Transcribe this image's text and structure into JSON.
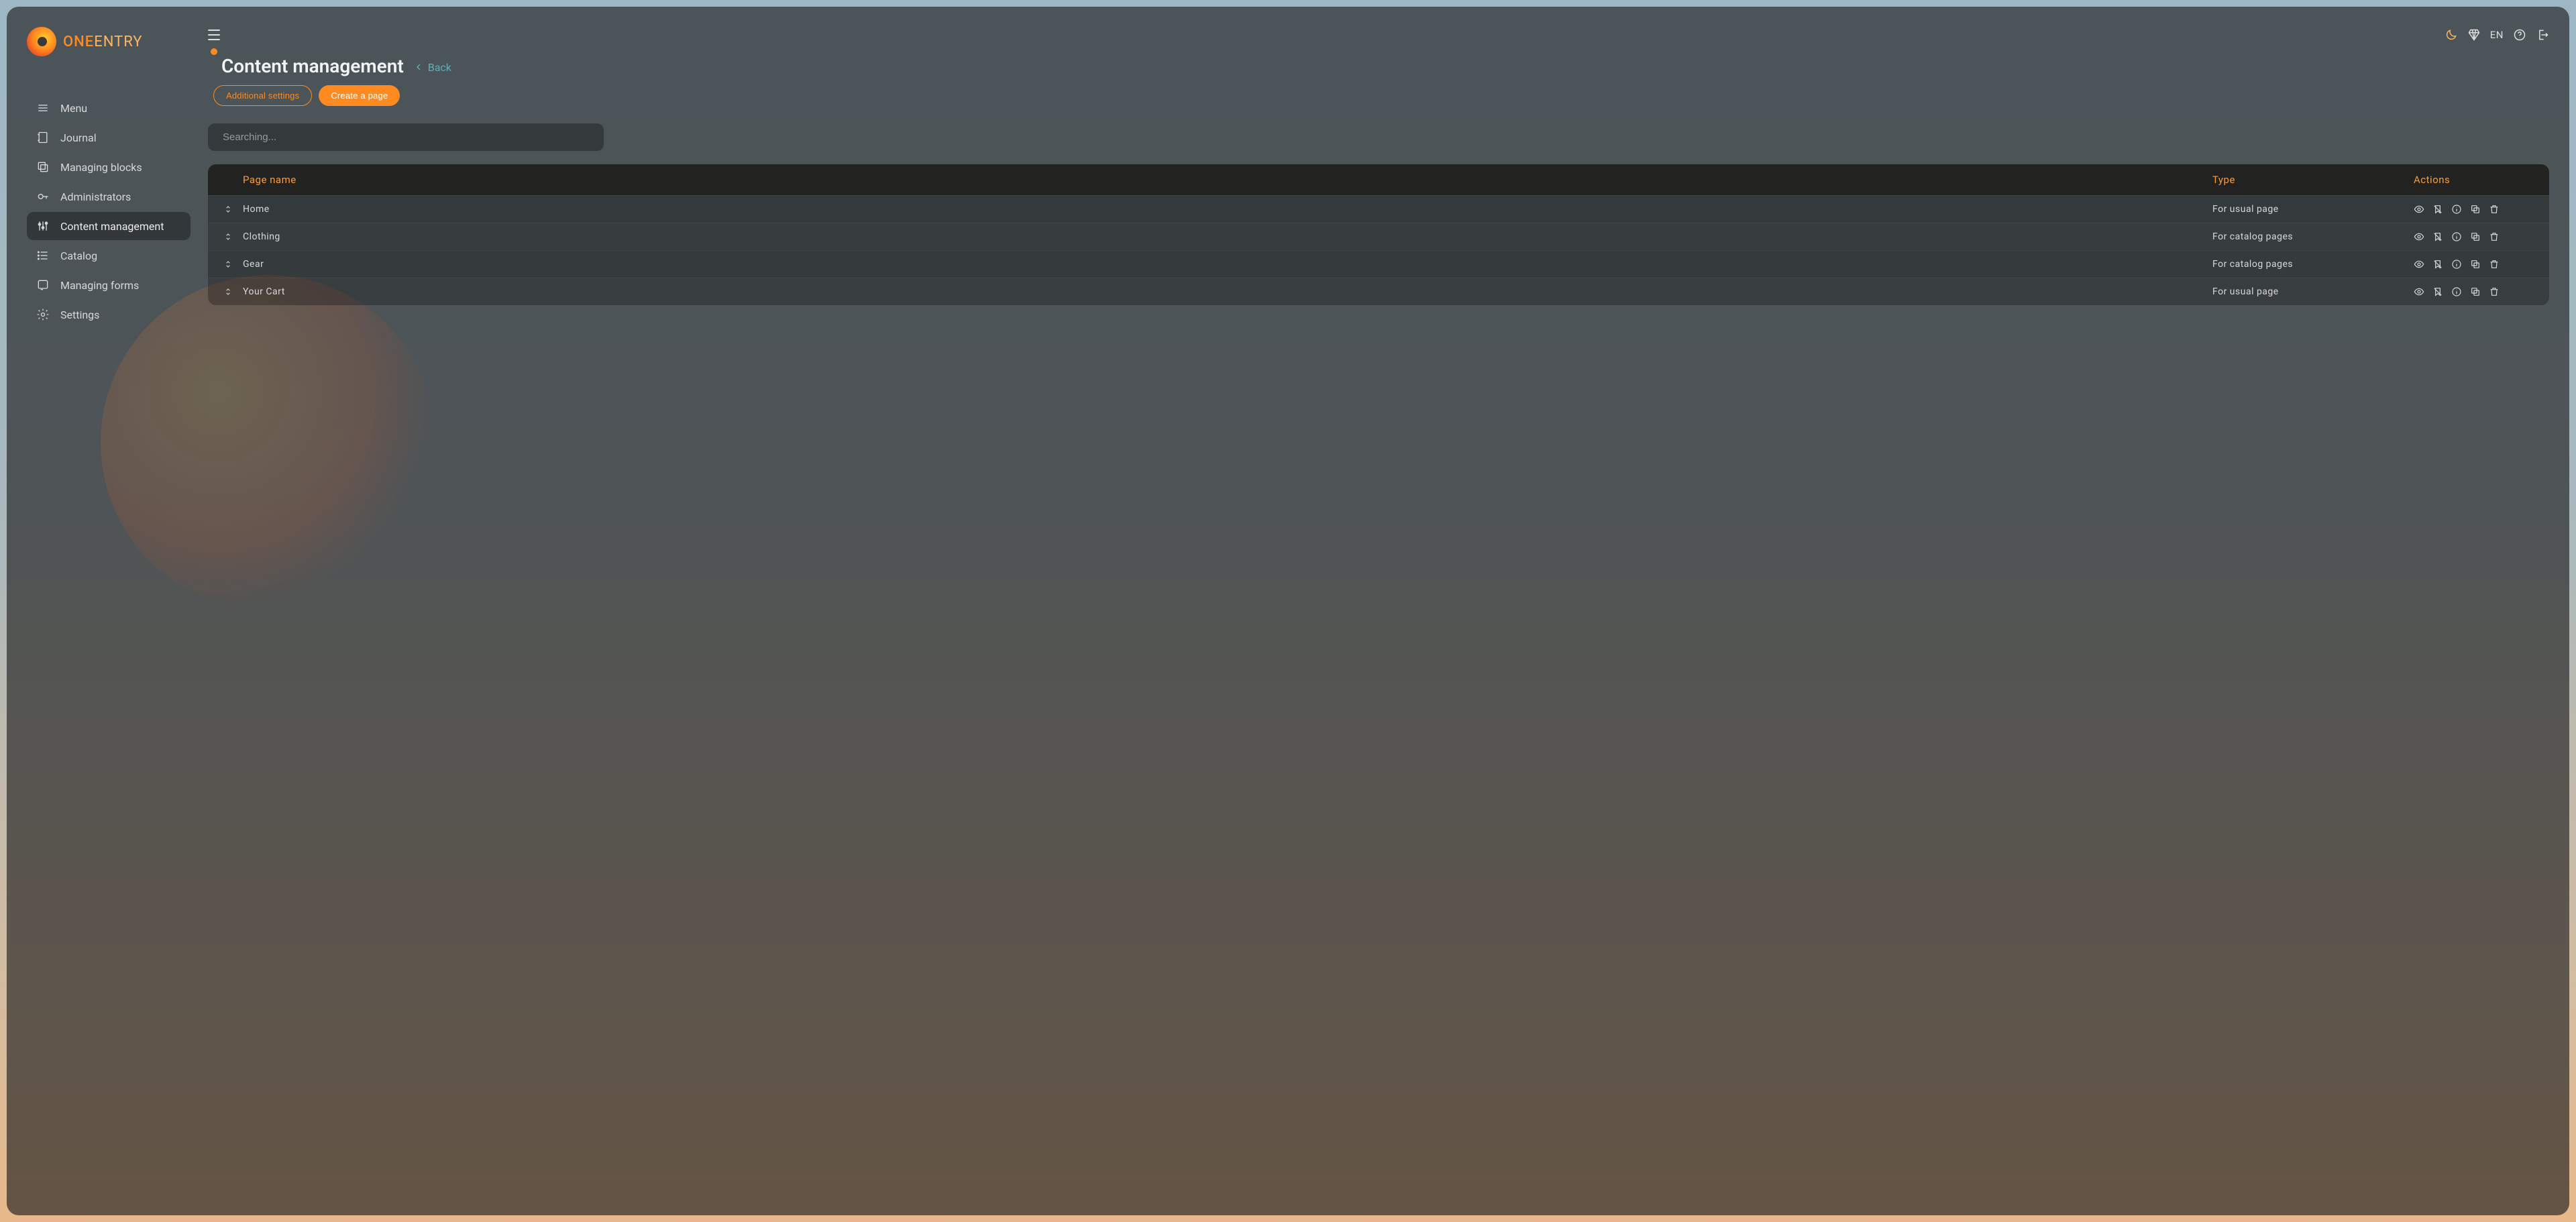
{
  "brand": {
    "name_a": "ONE",
    "name_b": "ENTRY"
  },
  "sidebar": {
    "items": [
      {
        "label": "Menu",
        "icon": "menu"
      },
      {
        "label": "Journal",
        "icon": "journal"
      },
      {
        "label": "Managing blocks",
        "icon": "blocks"
      },
      {
        "label": "Administrators",
        "icon": "key"
      },
      {
        "label": "Content management",
        "icon": "sliders",
        "active": true
      },
      {
        "label": "Catalog",
        "icon": "list"
      },
      {
        "label": "Managing forms",
        "icon": "forms"
      },
      {
        "label": "Settings",
        "icon": "gear"
      }
    ]
  },
  "topbar": {
    "language": "EN"
  },
  "page": {
    "title": "Content management",
    "back": "Back",
    "buttons": {
      "additional": "Additional settings",
      "create": "Create a page"
    },
    "search_placeholder": "Searching..."
  },
  "table": {
    "headers": {
      "name": "Page name",
      "type": "Type",
      "actions": "Actions"
    },
    "rows": [
      {
        "name": "Home",
        "type": "For usual page"
      },
      {
        "name": "Clothing",
        "type": "For catalog pages"
      },
      {
        "name": "Gear",
        "type": "For catalog pages"
      },
      {
        "name": "Your Cart",
        "type": "For usual page"
      }
    ]
  },
  "row_action_icons": [
    "eye",
    "bookmark-off",
    "info",
    "copy",
    "trash"
  ]
}
